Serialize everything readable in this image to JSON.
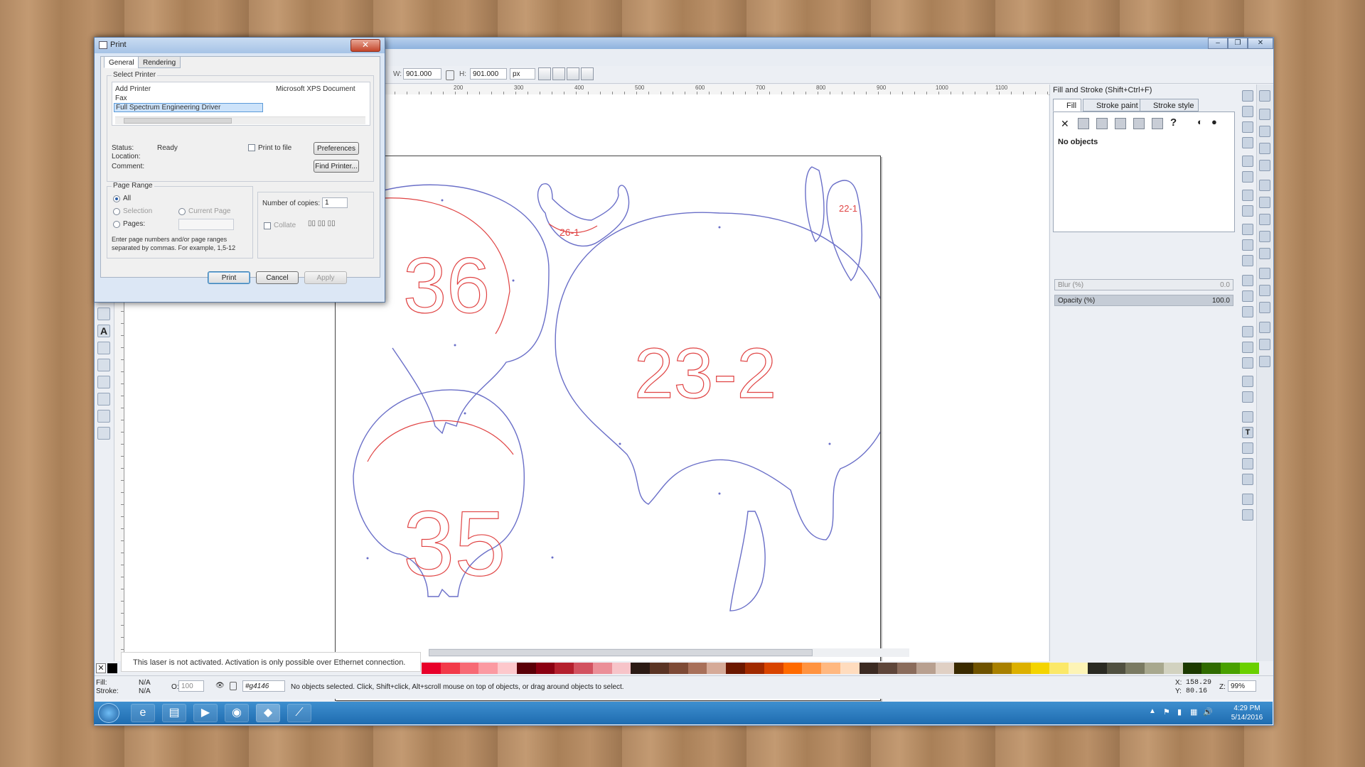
{
  "print_dialog": {
    "title": "Print",
    "tabs": [
      "General",
      "Rendering"
    ],
    "select_printer_label": "Select Printer",
    "printers": [
      "Add Printer",
      "Fax",
      "Full Spectrum Engineering Driver",
      "Microsoft XPS Document"
    ],
    "status_label": "Status:",
    "status_value": "Ready",
    "location_label": "Location:",
    "comment_label": "Comment:",
    "print_to_file": "Print to file",
    "preferences_button": "Preferences",
    "find_printer_button": "Find Printer...",
    "page_range_label": "Page Range",
    "range_all": "All",
    "range_selection": "Selection",
    "range_current_page": "Current Page",
    "range_pages": "Pages:",
    "range_hint": "Enter page numbers and/or page ranges separated by commas.  For example, 1,5-12",
    "copies_label": "Number of copies:",
    "copies_value": "1",
    "collate": "Collate",
    "print_button": "Print",
    "cancel_button": "Cancel",
    "apply_button": "Apply"
  },
  "controls": {
    "w_label": "W:",
    "w_value": "901.000",
    "h_label": "H:",
    "h_value": "901.000",
    "unit": "px"
  },
  "ruler_top_labels": [
    "200",
    "300",
    "400",
    "500",
    "600",
    "700",
    "800",
    "900",
    "1000",
    "1100"
  ],
  "fill_stroke": {
    "title": "Fill and Stroke (Shift+Ctrl+F)",
    "tabs": [
      "Fill",
      "Stroke paint",
      "Stroke style"
    ],
    "no_objects": "No objects",
    "blur_label": "Blur (%)",
    "blur_value": "0.0",
    "opacity_label": "Opacity (%)",
    "opacity_value": "100.0"
  },
  "canvas_labels": [
    "36",
    "26-1",
    "22-1",
    "23-2",
    "35"
  ],
  "toast": "This laser is not activated. Activation is only possible over Ethernet connection.",
  "status": {
    "fill_label": "Fill:",
    "fill_value": "N/A",
    "stroke_label": "Stroke:",
    "stroke_value": "N/A",
    "o_label": "O:",
    "o_value": "100",
    "layer": "#g4146",
    "message": "No objects selected. Click, Shift+click, Alt+scroll mouse on top of objects, or drag around objects to select.",
    "x_label": "X:",
    "x_value": "158.29",
    "y_label": "Y:",
    "y_value": "80.16",
    "z_label": "Z:",
    "z_value": "99%"
  },
  "taskbar": {
    "time": "4:29 PM",
    "date": "5/14/2016"
  },
  "colors": {
    "outline": "#6a6fc8",
    "label_red": "#e04444",
    "taskbar": "#2b7cc0"
  }
}
